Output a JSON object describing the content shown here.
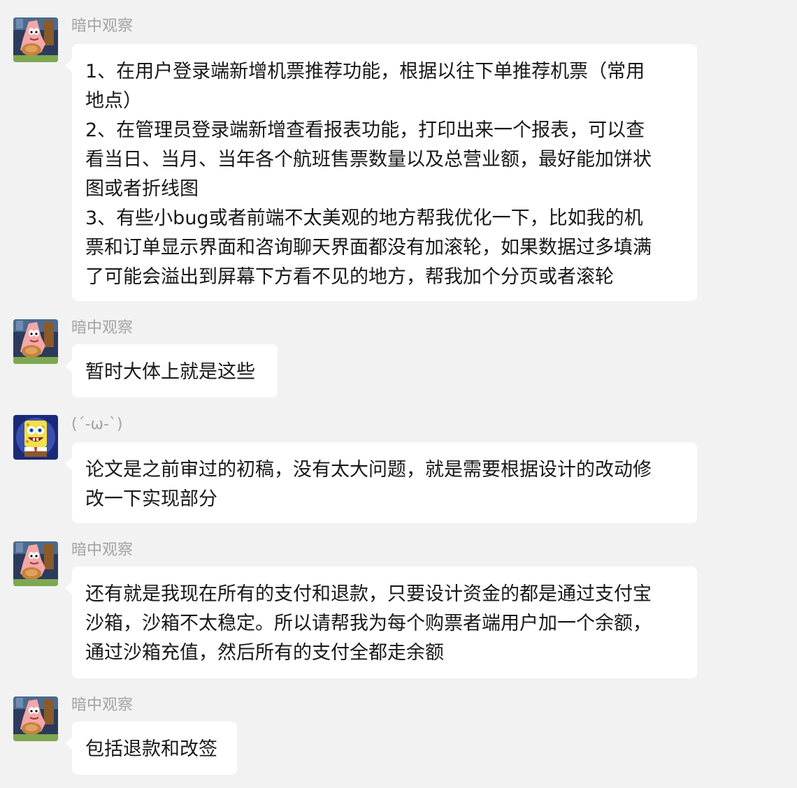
{
  "messages": [
    {
      "sender": "暗中观察",
      "avatar_icon": "patrick-star-avatar-icon",
      "text": "1、在用户登录端新增机票推荐功能，根据以往下单推荐机票（常用\n地点）\n2、在管理员登录端新增查看报表功能，打印出来一个报表，可以查\n看当日、当月、当年各个航班售票数量以及总营业额，最好能加饼状\n图或者折线图\n3、有些小bug或者前端不太美观的地方帮我优化一下，比如我的机\n票和订单显示界面和咨询聊天界面都没有加滚轮，如果数据过多填满\n了可能会溢出到屏幕下方看不见的地方，帮我加个分页或者滚轮"
    },
    {
      "sender": "暗中观察",
      "avatar_icon": "patrick-star-avatar-icon",
      "text": "暂时大体上就是这些"
    },
    {
      "sender": "(´-ω-`)",
      "avatar_icon": "spongebob-avatar-icon",
      "text": "论文是之前审过的初稿，没有太大问题，就是需要根据设计的改动修\n改一下实现部分"
    },
    {
      "sender": "暗中观察",
      "avatar_icon": "patrick-star-avatar-icon",
      "text": "还有就是我现在所有的支付和退款，只要设计资金的都是通过支付宝\n沙箱，沙箱不太稳定。所以请帮我为每个购票者端用户加一个余额，\n通过沙箱充值，然后所有的支付全都走余额"
    },
    {
      "sender": "暗中观察",
      "avatar_icon": "patrick-star-avatar-icon",
      "text": "包括退款和改签"
    }
  ],
  "colors": {
    "background": "#f2f2f2",
    "bubble": "#ffffff",
    "sender_name": "#a3a3a3",
    "message_text": "#181818"
  }
}
